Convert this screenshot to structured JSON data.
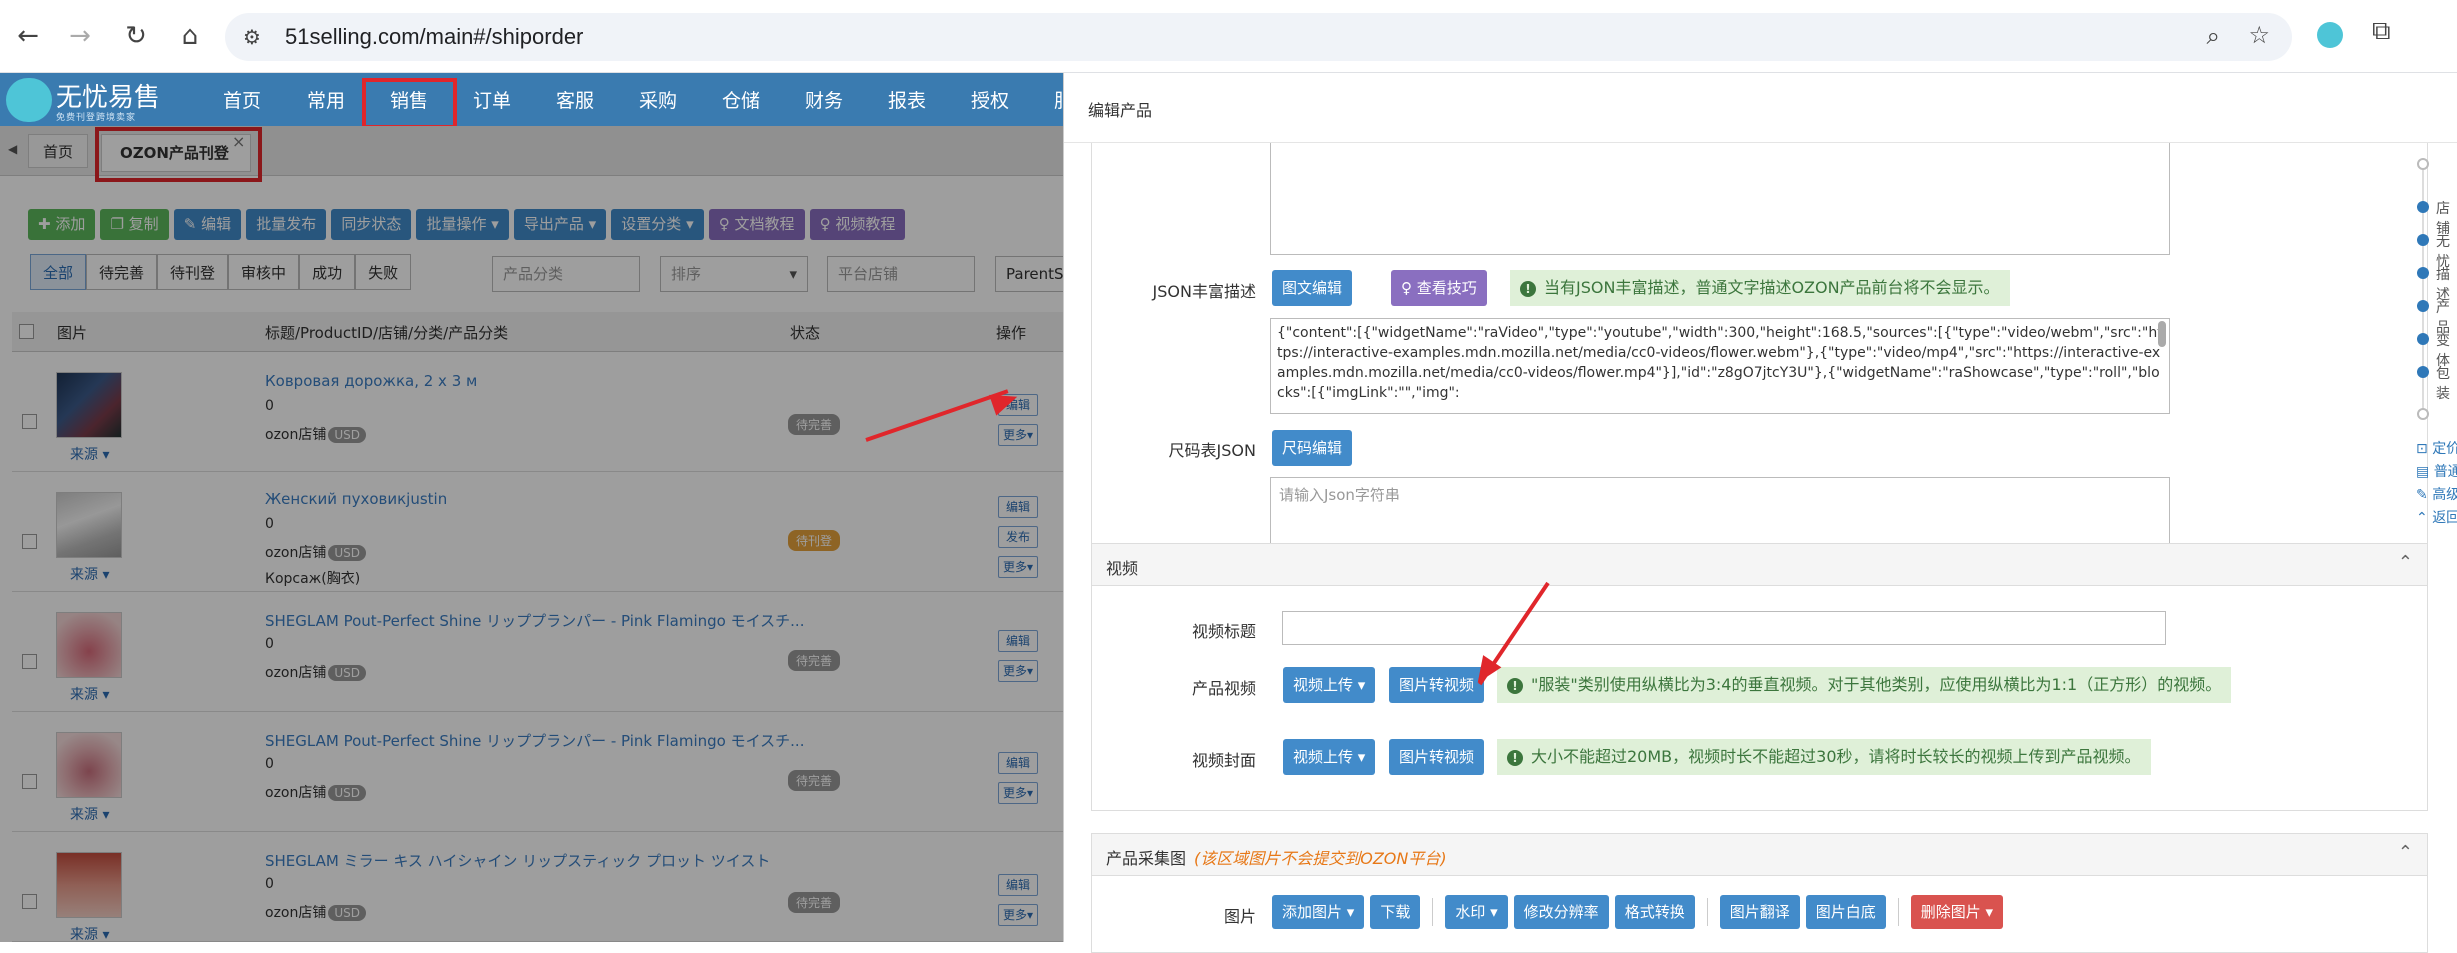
{
  "browser": {
    "url": "51selling.com/main#/shiporder",
    "icons": [
      "back-icon",
      "forward-icon",
      "reload-icon",
      "home-icon",
      "site-settings-icon",
      "zoom-icon",
      "star-icon",
      "extension-icon",
      "puzzle-icon"
    ]
  },
  "app": {
    "logo_title": "无忧易售",
    "logo_sub": "免费刊登跨境卖家",
    "menu": [
      "首页",
      "常用",
      "销售",
      "订单",
      "客服",
      "采购",
      "仓储",
      "财务",
      "报表",
      "授权",
      "服"
    ],
    "active_menu": "销售"
  },
  "tabs": {
    "home": "首页",
    "current": "OZON产品刊登",
    "close": "×"
  },
  "toolbar": {
    "add": "添加",
    "copy": "复制",
    "edit": "编辑",
    "batch_publish": "批量发布",
    "sync": "同步状态",
    "batch_ops": "批量操作",
    "export": "导出产品",
    "set_category": "设置分类",
    "doc": "文档教程",
    "video": "视频教程"
  },
  "filters": {
    "items": [
      "全部",
      "待完善",
      "待刊登",
      "审核中",
      "成功",
      "失败"
    ],
    "category_placeholder": "产品分类",
    "sort_placeholder": "排序",
    "shop_placeholder": "平台店铺",
    "parent_sku": "ParentSK"
  },
  "table": {
    "headers": [
      "图片",
      "标题/ProductID/店铺/分类/产品分类",
      "状态",
      "操作"
    ],
    "source_label": "来源",
    "rows": [
      {
        "title": "Ковровая дорожка, 2 x 3 м",
        "pid": "0",
        "shop": "ozon店铺",
        "currency": "USD",
        "category": "",
        "status": "待完善",
        "ops": [
          "编辑",
          "更多"
        ]
      },
      {
        "title": "Женский пуховикjustin",
        "pid": "0",
        "shop": "ozon店铺",
        "currency": "USD",
        "category": "Корсаж(胸衣)",
        "status": "待刊登",
        "ops": [
          "编辑",
          "发布",
          "更多"
        ]
      },
      {
        "title": "SHEGLAM Pout-Perfect Shine リッププランパー - Pink Flamingo モイスチ...",
        "pid": "0",
        "shop": "ozon店铺",
        "currency": "USD",
        "category": "",
        "status": "待完善",
        "ops": [
          "编辑",
          "更多"
        ]
      },
      {
        "title": "SHEGLAM Pout-Perfect Shine リッププランパー - Pink Flamingo モイスチ...",
        "pid": "0",
        "shop": "ozon店铺",
        "currency": "USD",
        "category": "",
        "status": "待完善",
        "ops": [
          "编辑",
          "更多"
        ]
      },
      {
        "title": "SHEGLAM ミラー キス ハイシャイン リップスティック プロット ツイスト",
        "pid": "0",
        "shop": "ozon店铺",
        "currency": "USD",
        "category": "",
        "status": "待完善",
        "ops": [
          "编辑",
          "更多"
        ]
      }
    ]
  },
  "panel": {
    "title": "编辑产品",
    "json_rich": {
      "label": "JSON丰富描述",
      "btn_edit": "图文编辑",
      "btn_tips": "查看技巧",
      "tip": "当有JSON丰富描述，普通文字描述OZON产品前台将不会显示。",
      "content": "{\"content\":[{\"widgetName\":\"raVideo\",\"type\":\"youtube\",\"width\":300,\"height\":168.5,\"sources\":[{\"type\":\"video/webm\",\"src\":\"https://interactive-examples.mdn.mozilla.net/media/cc0-videos/flower.webm\"},{\"type\":\"video/mp4\",\"src\":\"https://interactive-examples.mdn.mozilla.net/media/cc0-videos/flower.mp4\"}],\"id\":\"z8gO7jtcY3U\"},{\"widgetName\":\"raShowcase\",\"type\":\"roll\",\"blocks\":[{\"imgLink\":\"\",\"img\":"
    },
    "size_json": {
      "label": "尺码表JSON",
      "btn": "尺码编辑",
      "placeholder": "请输入Json字符串"
    },
    "video": {
      "section_title": "视频",
      "title_label": "视频标题",
      "product_video_label": "产品视频",
      "upload_btn": "视频上传",
      "convert_btn": "图片转视频",
      "product_video_tip": "\"服装\"类别使用纵横比为3:4的垂直视频。对于其他类别，应使用纵横比为1:1（正方形）的视频。",
      "cover_label": "视频封面",
      "cover_tip": "大小不能超过20MB，视频时长不能超过30秒，请将时长较长的视频上传到产品视频。"
    },
    "gallery": {
      "section_title": "产品采集图",
      "section_note": "(该区域图片不会提交到OZON平台)",
      "img_label": "图片",
      "buttons": [
        "添加图片",
        "下载",
        "水印",
        "修改分辨率",
        "格式转换",
        "图片翻译",
        "图片白底",
        "删除图片"
      ]
    },
    "side_nav": [
      "店铺",
      "无忧",
      "描述",
      "产品",
      "变体",
      "包装"
    ],
    "side_links": [
      "定价",
      "普通",
      "高级",
      "返回"
    ]
  },
  "colors": {
    "primary": "#428bca",
    "accent_red": "#e0262b",
    "header_blue": "#3a7bb0"
  }
}
